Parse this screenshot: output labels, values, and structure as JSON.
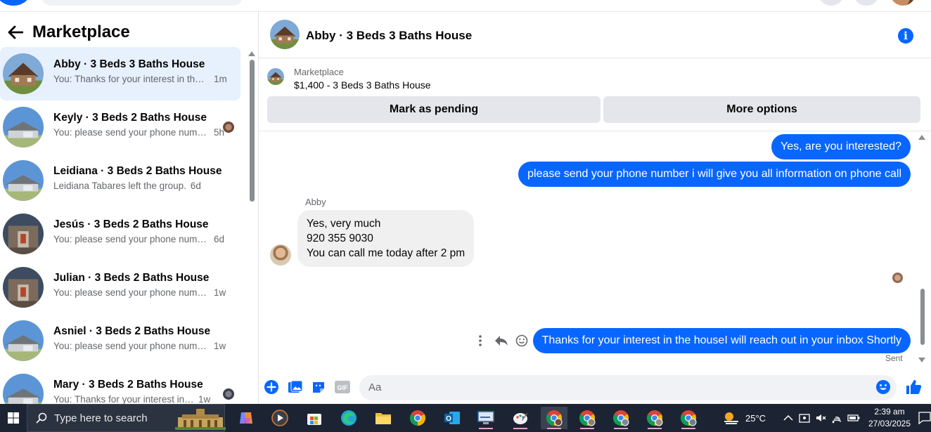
{
  "sidebar": {
    "title": "Marketplace",
    "conversations": [
      {
        "name": "Abby · 3 Beds 3 Baths House",
        "snippet": "You: Thanks for your interest in the house I will reach out in your inbox Shortly",
        "time": "1m",
        "active": true
      },
      {
        "name": "Keyly · 3 Beds 2 Baths House",
        "snippet": "You: please send your phone number i will give you all information on phone call",
        "time": "5h"
      },
      {
        "name": "Leidiana · 3 Beds 2 Baths House",
        "snippet": "Leidiana Tabares left the group.",
        "time": "6d"
      },
      {
        "name": "Jesús · 3 Beds 2 Baths House",
        "snippet": "You: please send your phone number i will give you all information on phone call",
        "time": "6d"
      },
      {
        "name": "Julian · 3 Beds 2 Baths House",
        "snippet": "You: please send your phone number i will give you all information on phone call",
        "time": "1w"
      },
      {
        "name": "Asniel · 3 Beds 2 Baths House",
        "snippet": "You: please send your phone number i will give you all information on phone call",
        "time": "1w"
      },
      {
        "name": "Mary · 3 Beds 2 Baths House",
        "snippet": "You: Thanks for your interest in the house I will reach out in your inbox Shortly",
        "time": "1w"
      }
    ]
  },
  "chat": {
    "title": "Abby · 3 Beds 3 Baths House",
    "listing_label": "Marketplace",
    "listing_price": "$1,400 - 3 Beds 3 Baths House",
    "mark_pending_label": "Mark as pending",
    "more_options_label": "More options",
    "messages": {
      "out_1": "Yes, are you interested?",
      "out_2": "please send your phone number i will give you all information on phone call",
      "sender_name": "Abby",
      "in_line_1": "Yes, very much",
      "in_line_2": "920 355 9030",
      "in_line_3": "You can call me today after 2 pm",
      "out_3": "Thanks for your interest in the houseI will reach out in your inbox Shortly",
      "status": "Sent"
    },
    "composer_placeholder": "Aa"
  },
  "taskbar": {
    "search_placeholder": "Type here to search",
    "weather": "25°C",
    "time": "2:39 am",
    "date": "27/03/2025"
  },
  "colors": {
    "accent": "#0866ff",
    "active_conversation": "#e7f0fd",
    "taskbar": "#1c2433"
  }
}
